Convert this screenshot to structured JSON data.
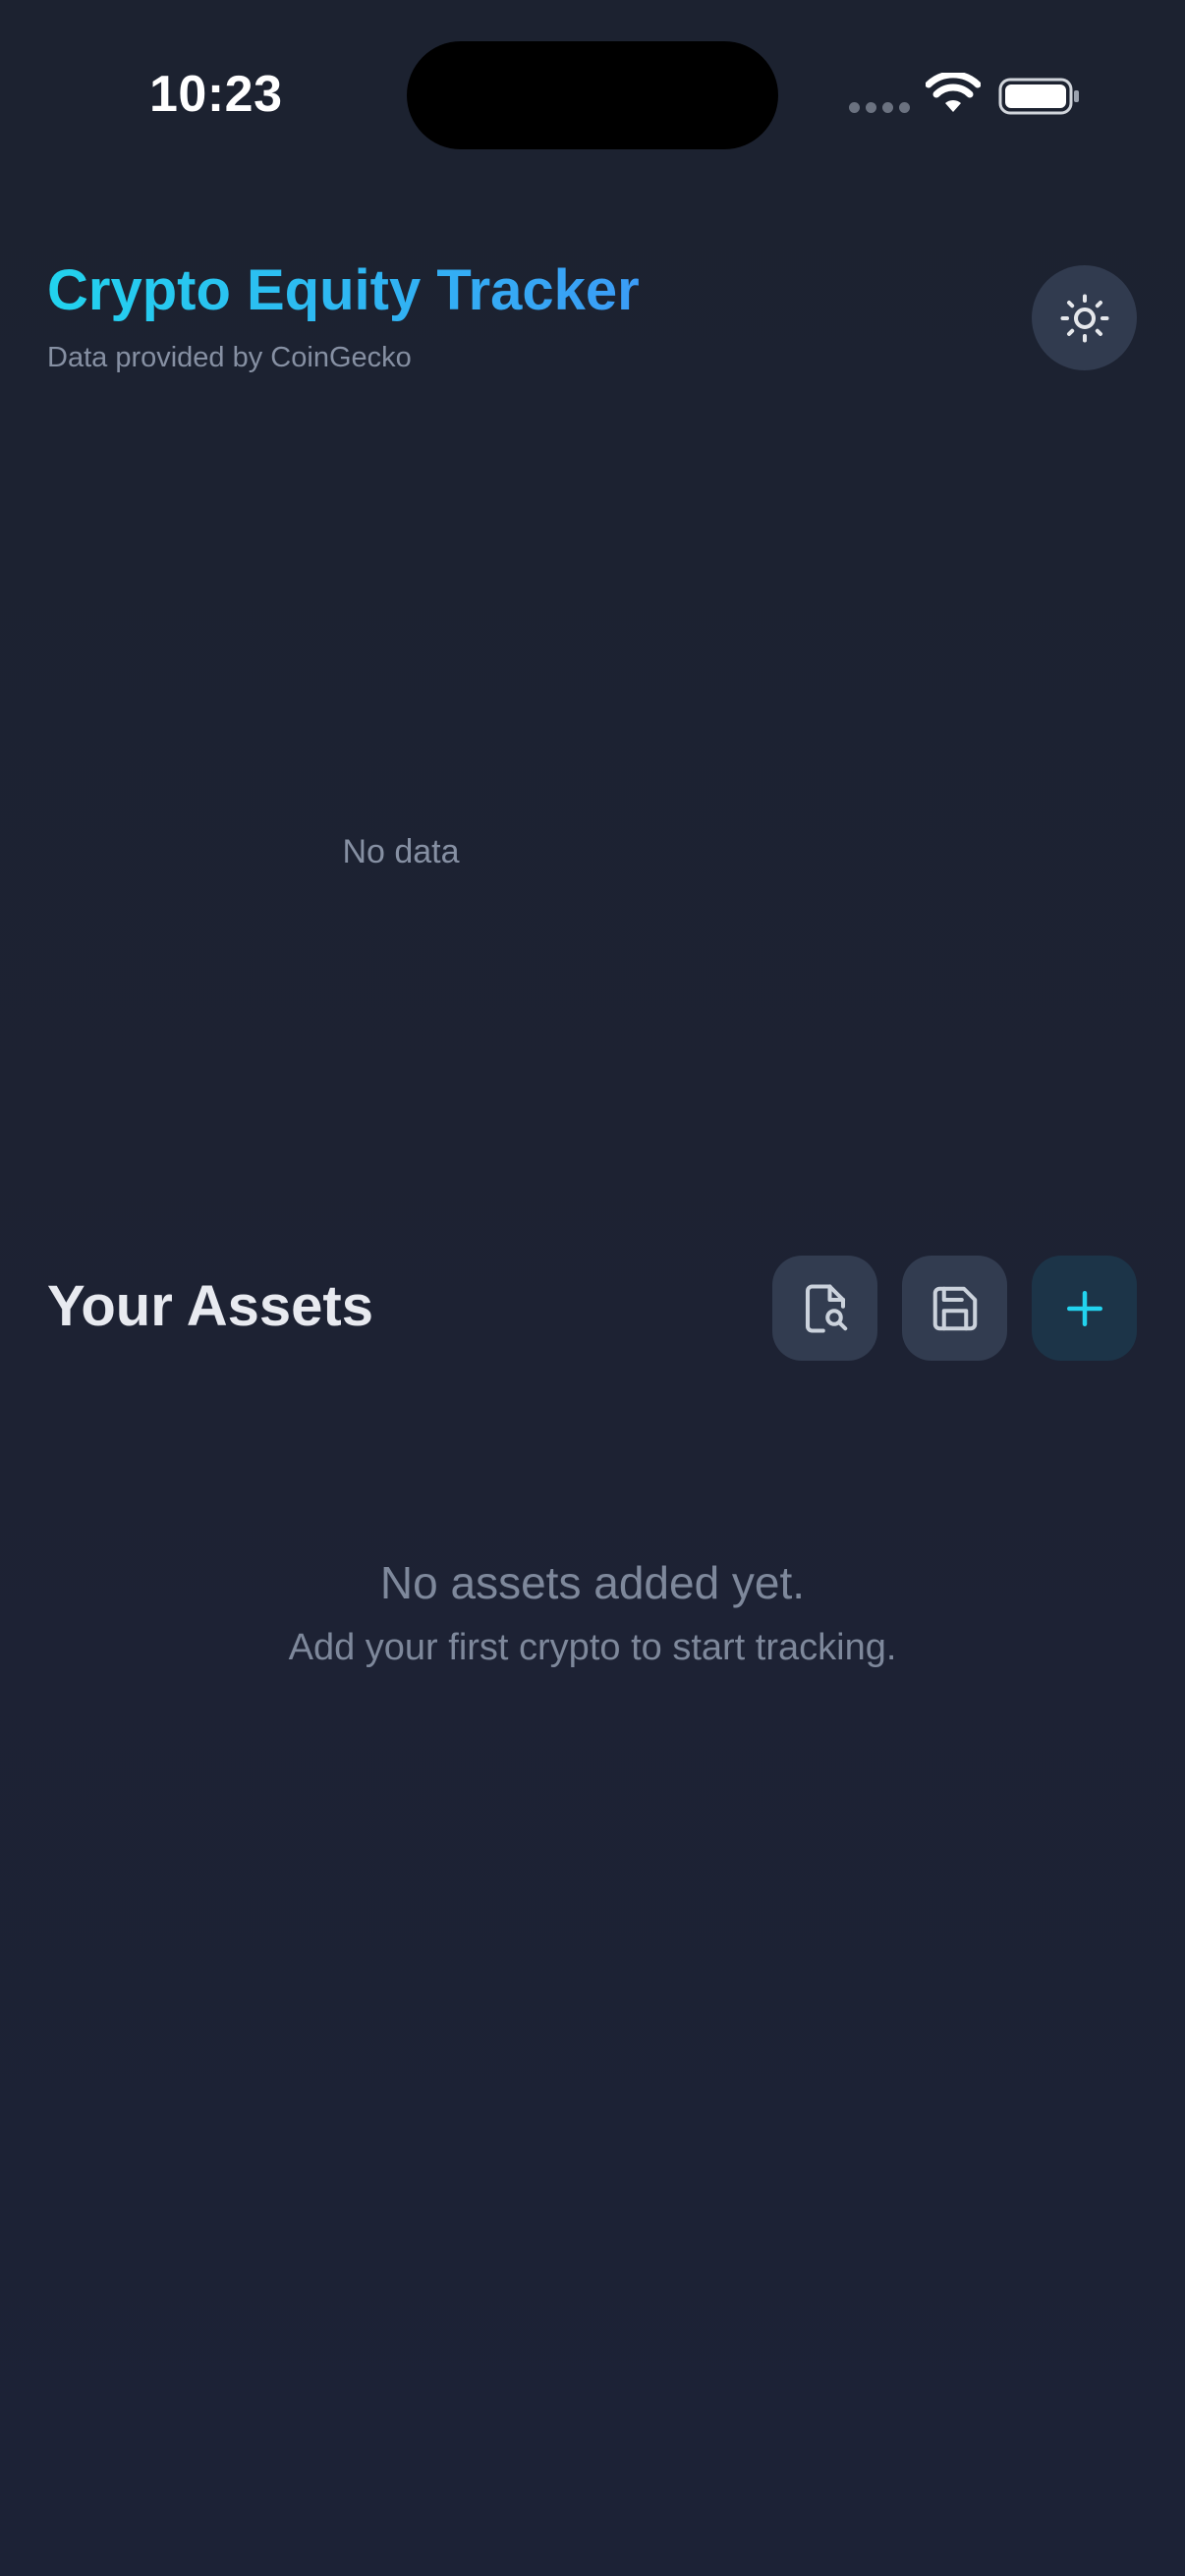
{
  "status_bar": {
    "time": "10:23",
    "icons": [
      "signal-icon",
      "wifi-icon",
      "battery-icon"
    ]
  },
  "header": {
    "title": "Crypto Equity Tracker",
    "subtitle": "Data provided by CoinGecko",
    "theme_toggle_icon": "sun-icon"
  },
  "chart": {
    "empty_text": "No data"
  },
  "assets": {
    "title": "Your Assets",
    "buttons": [
      {
        "icon": "file-search-icon"
      },
      {
        "icon": "save-icon"
      },
      {
        "icon": "plus-icon"
      }
    ],
    "empty_title": "No assets added yet.",
    "empty_subtitle": "Add your first crypto to start tracking."
  },
  "colors": {
    "background": "#1c2233",
    "title_gradient_start": "#22d3ee",
    "title_gradient_end": "#3b9cf6",
    "button_bg": "#323c50",
    "accent": "#22d3ee",
    "muted_text": "#7e889b"
  }
}
